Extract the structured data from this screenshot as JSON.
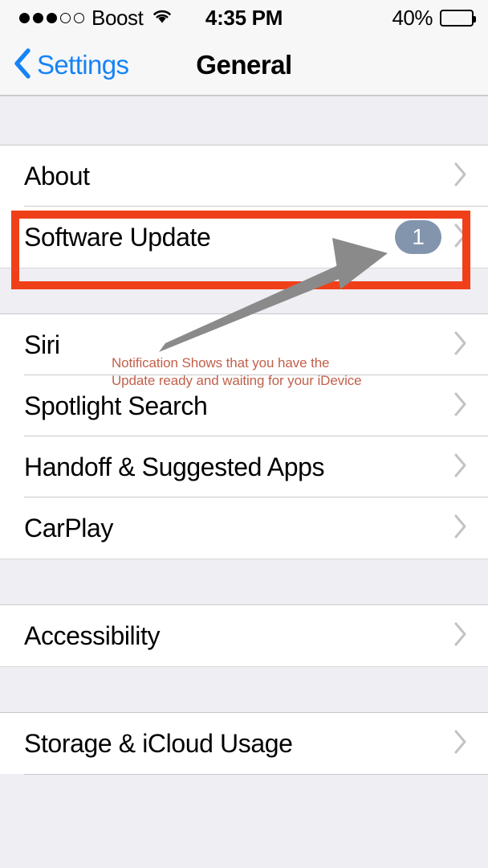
{
  "status_bar": {
    "signal": {
      "total_dots": 5,
      "filled_dots": 3,
      "icon": "signal-strength-dots"
    },
    "carrier": "Boost",
    "wifi_icon": "wifi-icon",
    "time": "4:35 PM",
    "battery_percent_label": "40%",
    "battery_level": 40,
    "battery_icon": "battery-icon"
  },
  "nav_bar": {
    "back_label": "Settings",
    "back_icon": "chevron-left-icon",
    "title": "General",
    "back_tint": "#1683f7"
  },
  "groups": [
    {
      "rows": [
        {
          "label": "About",
          "accessory": "chevron-right-icon",
          "badge": null
        },
        {
          "label": "Software Update",
          "accessory": "chevron-right-icon",
          "badge": "1",
          "highlighted": true
        }
      ]
    },
    {
      "rows": [
        {
          "label": "Siri",
          "accessory": "chevron-right-icon",
          "badge": null
        },
        {
          "label": "Spotlight Search",
          "accessory": "chevron-right-icon",
          "badge": null
        },
        {
          "label": "Handoff & Suggested Apps",
          "accessory": "chevron-right-icon",
          "badge": null
        },
        {
          "label": "CarPlay",
          "accessory": "chevron-right-icon",
          "badge": null
        }
      ]
    },
    {
      "rows": [
        {
          "label": "Accessibility",
          "accessory": "chevron-right-icon",
          "badge": null
        }
      ]
    },
    {
      "rows": [
        {
          "label": "Storage & iCloud Usage",
          "accessory": "chevron-right-icon",
          "badge": null
        }
      ]
    }
  ],
  "annotation": {
    "text": "Notification Shows that you have the Update ready and waiting for your iDevice",
    "text_color": "#c1604a",
    "highlight_color": "#f0401a",
    "arrow_color": "#8a8a8a",
    "arrow_icon": "callout-arrow-icon",
    "highlight_target": "Software Update",
    "badge_color": "#8394ad"
  }
}
